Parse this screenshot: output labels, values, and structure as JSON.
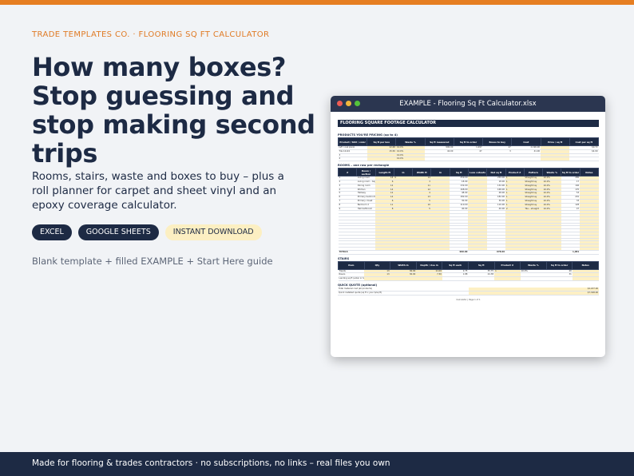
{
  "brand": {
    "kicker": "TRADE TEMPLATES CO.  ·  FLOORING SQ FT CALCULATOR",
    "accent_color": "#e67e22",
    "navy_color": "#1d2a44"
  },
  "hero": {
    "headline": "How many boxes? Stop guessing and stop making second trips",
    "subhead": "Rooms, stairs, waste and boxes to buy – plus a roll planner for carpet and sheet vinyl and an epoxy coverage calculator."
  },
  "pills": [
    "EXCEL",
    "GOOGLE SHEETS",
    "INSTANT DOWNLOAD"
  ],
  "included": "Blank template  +  filled EXAMPLE  +  Start Here guide",
  "window": {
    "title": "EXAMPLE - Flooring Sq Ft Calculator.xlsx",
    "sheet_title": "FLOORING SQUARE FOOTAGE CALCULATOR",
    "products_heading": "PRODUCTS YOU'RE PRICING (up to 4)",
    "rooms_heading": "ROOMS – one row per rectangle",
    "stairs_heading": "STAIRS",
    "quote_heading": "QUICK QUOTE (optional)",
    "products_cols": [
      "Product / SKU / color",
      "Sq ft per box",
      "Waste %",
      "Sq ft measured",
      "Sq ft to order",
      "Boxes to buy",
      "Cost",
      "Price / sq ft",
      "Cost per sq ft"
    ],
    "products_rows": [
      [
        "LVP / oak plank",
        "22.68",
        "10.0%",
        "990.00",
        "1,097",
        "47",
        "2,196.00",
        "",
        "$0.72"
      ],
      [
        "Tile 12x24",
        "15.50",
        "10.0%",
        "42.00",
        "47",
        "3",
        "41.00",
        "",
        "$4.90"
      ],
      [
        "3",
        "",
        "10.0%",
        "",
        "",
        "",
        "",
        "",
        ""
      ],
      [
        "4",
        "",
        "10.0%",
        "",
        "",
        "",
        "",
        "",
        ""
      ]
    ],
    "rooms_cols": [
      "#",
      "Room / section",
      "Length ft",
      "in",
      "Width ft",
      "in",
      "Sq ft",
      "Less cutouts",
      "Net sq ft",
      "Product #",
      "Pattern",
      "Waste %",
      "Sq ft to order",
      "Notes"
    ],
    "rooms_rows": [
      [
        "1",
        "Living room",
        "18",
        "6",
        "14",
        "",
        "259.00",
        "",
        "259.00",
        "1",
        "Straight lay",
        "10.0%",
        "285",
        ""
      ],
      [
        "2",
        "Living room – bay window",
        "6",
        "",
        "3",
        "",
        "18.00",
        "",
        "18.00",
        "1",
        "Straight lay",
        "10.0%",
        "17",
        ""
      ],
      [
        "3",
        "Dining room",
        "12",
        "",
        "11",
        "",
        "132.00",
        "",
        "132.00",
        "1",
        "Straight lay",
        "10.0%",
        "146",
        ""
      ],
      [
        "4",
        "Kitchen",
        "14",
        "",
        "12",
        "",
        "168.00",
        "",
        "168.00",
        "1",
        "Straight lay",
        "10.0%",
        "170",
        ""
      ],
      [
        "5",
        "Hallway",
        "12",
        "",
        "4",
        "",
        "48.00",
        "",
        "48.00",
        "1",
        "Straight lay",
        "10.0%",
        "53",
        ""
      ],
      [
        "6",
        "Primary bedroom",
        "14",
        "",
        "13",
        "",
        "182.00",
        "",
        "182.00",
        "1",
        "Straight lay",
        "10.0%",
        "201",
        ""
      ],
      [
        "7",
        "Primary closet",
        "6",
        "",
        "5",
        "",
        "30.00",
        "",
        "30.00",
        "1",
        "Straight lay",
        "10.0%",
        "33",
        ""
      ],
      [
        "8",
        "Bedroom 2",
        "11",
        "",
        "10",
        "",
        "110.00",
        "",
        "110.00",
        "1",
        "Straight lay",
        "10.0%",
        "128",
        ""
      ],
      [
        "9",
        "Hall bathroom",
        "8",
        "",
        "5",
        "",
        "40.00",
        "",
        "40.00",
        "2",
        "Tile – straight",
        "10.0%",
        "47",
        ""
      ]
    ],
    "rooms_total": [
      "TOTALS",
      "990.00",
      "978.00",
      "1,081"
    ],
    "stairs_cols": [
      "Item",
      "Qty",
      "Width in",
      "Depth / rise in",
      "Sq ft each",
      "Sq ft",
      "Product #",
      "Waste %",
      "Sq ft to order",
      "Notes"
    ],
    "stairs_rows": [
      [
        "Treads",
        "13",
        "36.00",
        "11.00",
        "2.75",
        "35.75",
        "1",
        "10.0%",
        "40",
        ""
      ],
      [
        "Risers",
        "13",
        "36.00",
        "7.50",
        "1.88",
        "24.38",
        "",
        "",
        "31",
        ""
      ],
      [
        "Landing sq ft (enter in Sq ft)",
        "",
        "",
        "",
        "",
        "",
        "",
        "",
        "",
        ""
      ]
    ],
    "quote_rows": [
      [
        "Total material cost (all products)",
        "$2,437.00"
      ],
      [
        "Quick installed quote (sq ft x your $/sq ft)",
        "$7,348.00"
      ]
    ],
    "sheet_footer": "Calculator  |  Page 1 of 1"
  },
  "footer": "Made for flooring & trades contractors  ·  no subscriptions, no links – real files you own"
}
